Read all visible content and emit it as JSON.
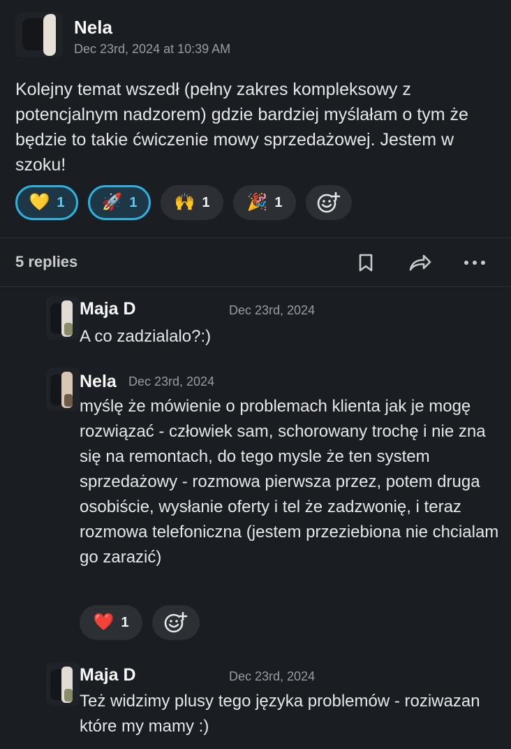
{
  "main_message": {
    "author": "Nela",
    "timestamp": "Dec 23rd, 2024 at 10:39 AM",
    "text": "Kolejny temat wszedł (pełny zakres kompleksowy z potencjalnym nadzorem) gdzie bardziej myślałam o tym że będzie to takie ćwiczenie mowy sprzedażowej. Jestem w szoku!",
    "reactions": [
      {
        "emoji": "💛",
        "count": "1",
        "active": true
      },
      {
        "emoji": "🚀",
        "count": "1",
        "active": true
      },
      {
        "emoji": "🙌",
        "count": "1",
        "active": false
      },
      {
        "emoji": "🎉",
        "count": "1",
        "active": false
      }
    ]
  },
  "thread": {
    "replies_label": "5 replies",
    "actions": [
      "bookmark-icon",
      "share-icon",
      "more-icon"
    ]
  },
  "replies": [
    {
      "author": "Maja D",
      "timestamp": "Dec 23rd, 2024",
      "text": "A co zadzialalo?:)"
    },
    {
      "author": "Nela",
      "timestamp": "Dec 23rd, 2024",
      "text": "myślę że mówienie o problemach klienta jak je mogę rozwiązać - człowiek sam, schorowany trochę i nie zna się na remontach, do tego mysle że ten system sprzedażowy - rozmowa pierwsza przez, potem druga osobiście, wysłanie oferty i tel że zadzwonię, i teraz rozmowa telefoniczna (jestem przeziebiona nie chcialam go zarazić)",
      "reactions": [
        {
          "emoji": "❤️",
          "count": "1"
        }
      ]
    },
    {
      "author": "Maja D",
      "timestamp": "Dec 23rd, 2024",
      "text": "Też widzimy plusy tego języka problemów - roziwazan które my mamy :)"
    }
  ],
  "colors": {
    "background": "#1a1d21",
    "accent": "#2bb3e0",
    "pill": "#2c2f34"
  }
}
